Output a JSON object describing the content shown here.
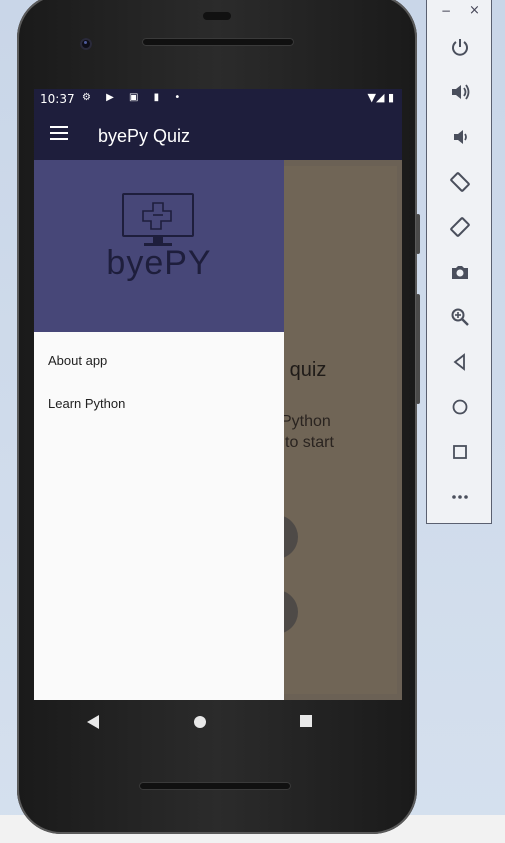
{
  "status_bar": {
    "time": "10:37",
    "left_icons": "⚙ ▶ ▣ ▮ •",
    "right_icons": "▼◢ ▮"
  },
  "app_bar": {
    "title": "byePy Quiz",
    "menu_icon": "hamburger-menu-icon"
  },
  "drawer": {
    "logo_text": "byePY",
    "items": [
      {
        "label": "About app"
      },
      {
        "label": "Learn Python"
      }
    ]
  },
  "background_content": {
    "logo_fragment": "/",
    "heading_fragment": "n quiz",
    "line1_fragment": "Python",
    "line2_fragment": "to start"
  },
  "navigation_bar": {
    "back": "back-icon",
    "home": "home-icon",
    "recents": "recents-icon"
  },
  "emulator_panel": {
    "minimize": "−",
    "close": "×",
    "buttons": [
      "power-icon",
      "volume-up-icon",
      "volume-down-icon",
      "rotate-left-icon",
      "rotate-right-icon",
      "screenshot-icon",
      "zoom-icon",
      "back-icon",
      "home-icon",
      "overview-icon",
      "more-icon"
    ]
  },
  "colors": {
    "app_bar": "#1e1e3c",
    "drawer_header": "#474778",
    "scrim": "#706556"
  }
}
